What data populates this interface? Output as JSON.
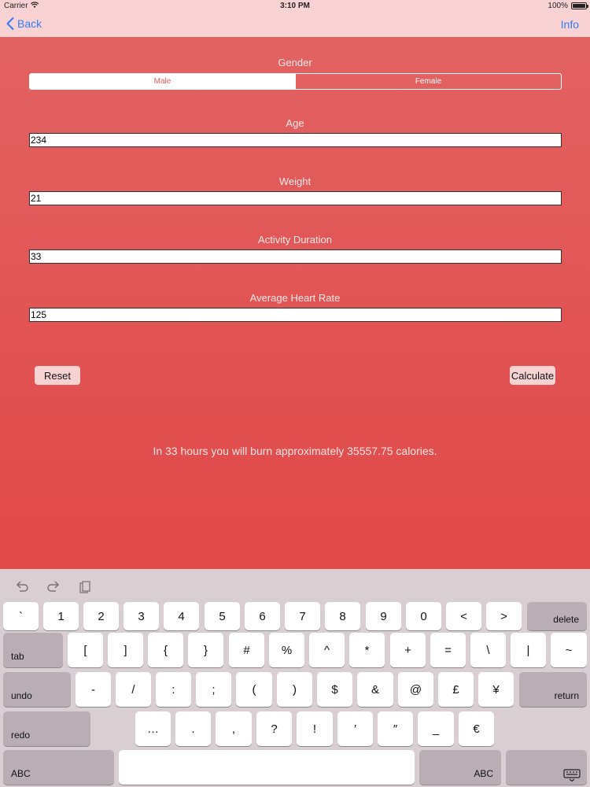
{
  "status_bar": {
    "carrier": "Carrier",
    "time": "3:10 PM",
    "battery": "100%"
  },
  "nav": {
    "back_label": "Back",
    "info_label": "Info"
  },
  "form": {
    "gender_label": "Gender",
    "gender_options": [
      "Male",
      "Female"
    ],
    "gender_selected": "Male",
    "age_label": "Age",
    "age_value": "234",
    "weight_label": "Weight",
    "weight_value": "21",
    "duration_label": "Activity Duration",
    "duration_value": "33",
    "heart_rate_label": "Average Heart Rate",
    "heart_rate_value": "125"
  },
  "buttons": {
    "reset": "Reset",
    "calculate": "Calculate"
  },
  "result_text": "In 33 hours you will burn approximately 35557.75 calories.",
  "keyboard": {
    "toolbar_icons": [
      "undo-arrow-icon",
      "redo-arrow-icon",
      "clipboard-icon"
    ],
    "row1": [
      "`",
      "1",
      "2",
      "3",
      "4",
      "5",
      "6",
      "7",
      "8",
      "9",
      "0",
      "<",
      ">"
    ],
    "row1_action": "delete",
    "row2_action": "tab",
    "row2": [
      "[",
      "]",
      "{",
      "}",
      "#",
      "%",
      "^",
      "*",
      "+",
      "=",
      "\\",
      "|",
      "~"
    ],
    "row3_action": "undo",
    "row3": [
      "-",
      "/",
      ":",
      ";",
      "(",
      ")",
      "$",
      "&",
      "@",
      "£",
      "¥"
    ],
    "row3_return": "return",
    "row4_action": "redo",
    "row4": [
      "…",
      ".",
      ",",
      "?",
      "!",
      "′",
      "″",
      "_",
      "€"
    ],
    "row5_left": "ABC",
    "row5_right": "ABC"
  },
  "colors": {
    "accent": "#2f7cf6",
    "background_top": "#e26262",
    "background_bottom": "#e14848",
    "nav_bar": "#f9d3d3",
    "button": "#f7d2d2"
  }
}
